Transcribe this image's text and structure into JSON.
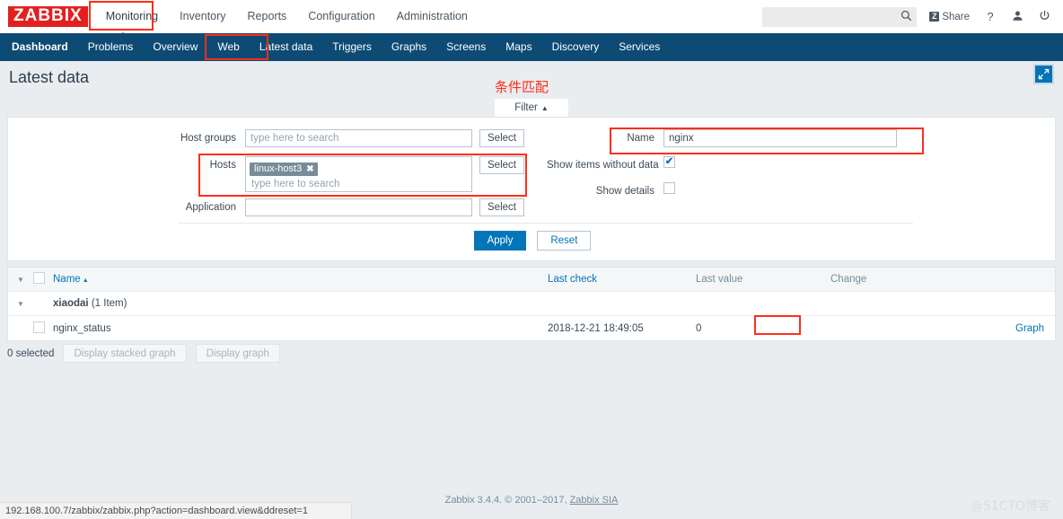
{
  "brand": {
    "logo": "ZABBIX"
  },
  "main_menu": {
    "items": [
      {
        "label": "Monitoring",
        "selected": true
      },
      {
        "label": "Inventory",
        "selected": false
      },
      {
        "label": "Reports",
        "selected": false
      },
      {
        "label": "Configuration",
        "selected": false
      },
      {
        "label": "Administration",
        "selected": false
      }
    ]
  },
  "header_right": {
    "search_placeholder": "",
    "search_value": "",
    "search_icon": "search-icon",
    "share_label": "Share",
    "share_badge": "Z",
    "help_icon": "?",
    "user_icon": "•",
    "signout_icon": "⏻"
  },
  "sub_menu": {
    "items": [
      {
        "label": "Dashboard",
        "active": false
      },
      {
        "label": "Problems",
        "active": false
      },
      {
        "label": "Overview",
        "active": false
      },
      {
        "label": "Web",
        "active": false
      },
      {
        "label": "Latest data",
        "active": true
      },
      {
        "label": "Triggers",
        "active": false
      },
      {
        "label": "Graphs",
        "active": false
      },
      {
        "label": "Screens",
        "active": false
      },
      {
        "label": "Maps",
        "active": false
      },
      {
        "label": "Discovery",
        "active": false
      },
      {
        "label": "Services",
        "active": false
      }
    ]
  },
  "page": {
    "title": "Latest data",
    "kiosk_icon": "expand-icon",
    "annotation": "条件匹配"
  },
  "filter": {
    "tab_label": "Filter",
    "tab_caret": "▲",
    "host_groups": {
      "label": "Host groups",
      "value": "",
      "placeholder": "type here to search",
      "select_label": "Select"
    },
    "hosts": {
      "label": "Hosts",
      "chips": [
        {
          "label": "linux-host3",
          "remove_icon": "✖"
        }
      ],
      "placeholder": "type here to search",
      "select_label": "Select"
    },
    "application": {
      "label": "Application",
      "value": "",
      "placeholder": "",
      "select_label": "Select"
    },
    "name": {
      "label": "Name",
      "value": "nginx",
      "placeholder": ""
    },
    "show_items_without_data": {
      "label": "Show items without data",
      "checked": true,
      "tick": "✔"
    },
    "show_details": {
      "label": "Show details",
      "checked": false,
      "tick": ""
    },
    "apply_label": "Apply",
    "reset_label": "Reset"
  },
  "table": {
    "columns": {
      "name": "Name",
      "last_check": "Last check",
      "last_value": "Last value",
      "change": "Change"
    },
    "sort_caret": "▲",
    "collapse_caret": "▼",
    "groups": [
      {
        "host": "xiaodai",
        "count_label": "(1 Item)",
        "items": [
          {
            "name": "nginx_status",
            "last_check": "2018-12-21 18:49:05",
            "last_value": "0",
            "change": "",
            "graph_label": "Graph"
          }
        ]
      }
    ]
  },
  "table_footer": {
    "selected_label": "0 selected",
    "stacked_graph_label": "Display stacked graph",
    "graph_label": "Display graph"
  },
  "footer": {
    "copyright": "Zabbix 3.4.4. © 2001–2017, ",
    "vendor_link": "Zabbix SIA",
    "watermark": "@51CTO博客",
    "status_url": "192.168.100.7/zabbix/zabbix.php?action=dashboard.view&ddreset=1"
  },
  "colors": {
    "brand_red": "#e32020",
    "nav_blue": "#0e4b74",
    "accent_blue": "#0275b8",
    "annotation_red": "#ff2d1a",
    "chip_gray": "#768d99"
  }
}
